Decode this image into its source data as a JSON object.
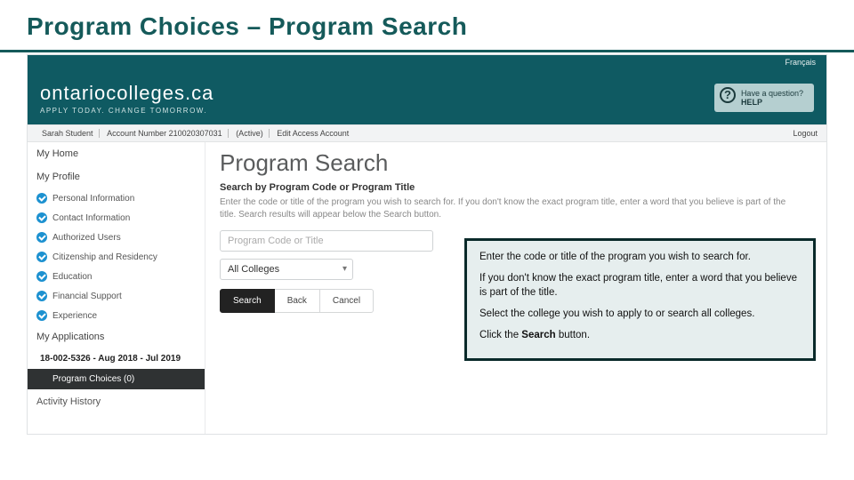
{
  "slide": {
    "title": "Program Choices – Program Search"
  },
  "top": {
    "lang_link": "Français"
  },
  "brand": {
    "name": "ontariocolleges.ca",
    "tagline": "APPLY TODAY. CHANGE TOMORROW.",
    "help_line1": "Have a question?",
    "help_line2": "HELP"
  },
  "userbar": {
    "name": "Sarah Student",
    "acct": "Account Number 210020307031",
    "status": "(Active)",
    "edit": "Edit Access Account",
    "logout": "Logout"
  },
  "sidebar": {
    "home": "My Home",
    "profile": "My Profile",
    "items": [
      {
        "label": "Personal Information"
      },
      {
        "label": "Contact Information"
      },
      {
        "label": "Authorized Users"
      },
      {
        "label": "Citizenship and Residency"
      },
      {
        "label": "Education"
      },
      {
        "label": "Financial Support"
      },
      {
        "label": "Experience"
      }
    ],
    "apps": "My Applications",
    "app_number": "18-002-5326 - Aug 2018 - Jul 2019",
    "choices": "Program Choices (0)",
    "history": "Activity History"
  },
  "main": {
    "title": "Program Search",
    "subhead": "Search by Program Code or Program Title",
    "desc": "Enter the code or title of the program you wish to search for. If you don't know the exact program title, enter a word that you believe is part of the title. Search results will appear below the Search button.",
    "placeholder": "Program Code or Title",
    "college_selected": "All Colleges",
    "btn_search": "Search",
    "btn_back": "Back",
    "btn_cancel": "Cancel"
  },
  "callout": {
    "p1": "Enter the code or title of the program you wish to search for.",
    "p2": "If you don't know the exact program title, enter a word that you believe is part of the title.",
    "p3": "Select the college you wish to apply to or search all colleges.",
    "p4_prefix": "Click the ",
    "p4_bold": "Search",
    "p4_suffix": " button."
  }
}
